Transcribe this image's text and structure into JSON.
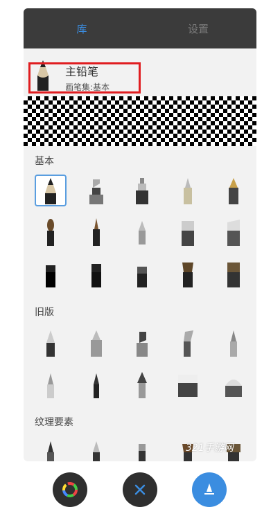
{
  "tabs": [
    {
      "label": "库",
      "active": true
    },
    {
      "label": "设置",
      "active": false
    }
  ],
  "current_brush": {
    "name": "主铅笔",
    "set": "画笔集:基本",
    "icon": "pencil-icon"
  },
  "sections": [
    {
      "title": "基本"
    },
    {
      "title": "旧版"
    },
    {
      "title": "纹理要素"
    }
  ],
  "bottom_buttons": [
    {
      "name": "color-wheel-icon"
    },
    {
      "name": "close-icon"
    },
    {
      "name": "brush-size-icon"
    }
  ],
  "watermark": "321手游网",
  "colors": {
    "accent": "#3b8de0",
    "tabbar": "#3b3b3b",
    "highlight": "#e01d20",
    "panel": "#f2f2f2"
  }
}
